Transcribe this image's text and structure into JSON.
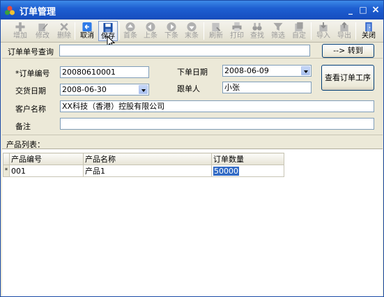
{
  "window": {
    "title": "订单管理"
  },
  "toolbar": {
    "buttons": [
      {
        "label": "增加",
        "icon": "plus-icon",
        "enabled": false
      },
      {
        "label": "修改",
        "icon": "edit-icon",
        "enabled": false
      },
      {
        "label": "删除",
        "icon": "delete-icon",
        "enabled": false
      },
      {
        "label": "取消",
        "icon": "undo-icon",
        "enabled": true
      },
      {
        "label": "保存",
        "icon": "save-icon",
        "enabled": true
      },
      {
        "label": "首条",
        "icon": "first-record-icon",
        "enabled": false
      },
      {
        "label": "上条",
        "icon": "previous-record-icon",
        "enabled": false
      },
      {
        "label": "下条",
        "icon": "next-record-icon",
        "enabled": false
      },
      {
        "label": "末条",
        "icon": "last-record-icon",
        "enabled": false
      },
      {
        "label": "刷新",
        "icon": "refresh-icon",
        "enabled": false
      },
      {
        "label": "打印",
        "icon": "print-icon",
        "enabled": false
      },
      {
        "label": "查找",
        "icon": "binoculars-icon",
        "enabled": false
      },
      {
        "label": "筛选",
        "icon": "filter-icon",
        "enabled": false
      },
      {
        "label": "自定",
        "icon": "customize-icon",
        "enabled": false
      },
      {
        "label": "导入",
        "icon": "import-icon",
        "enabled": false
      },
      {
        "label": "导出",
        "icon": "export-icon",
        "enabled": false
      },
      {
        "label": "关闭",
        "icon": "exit-door-icon",
        "enabled": true
      }
    ]
  },
  "search": {
    "label": "订单单号查询",
    "value": "",
    "goto_label": "--> 转到"
  },
  "form": {
    "order_no_label": "*订单编号",
    "order_no_value": "20080610001",
    "order_date_label": "下单日期",
    "order_date_value": "2008-06-09",
    "delivery_date_label": "交货日期",
    "delivery_date_value": "2008-06-30",
    "follower_label": "跟单人",
    "follower_value": "小张",
    "customer_label": "客户名称",
    "customer_value": "XX科技（香港）控股有限公司",
    "remark_label": "备注",
    "remark_value": "",
    "process_button_label": "查看订单工序"
  },
  "products": {
    "section_label": "产品列表：",
    "columns": [
      "产品编号",
      "产品名称",
      "订单数量"
    ],
    "rows": [
      {
        "code": "001",
        "name": "产品1",
        "qty": "50000"
      }
    ],
    "new_row_marker": "*"
  },
  "colors": {
    "titlebar": "#1e5fd1",
    "window_bg": "#ece9d8",
    "selection": "#316ac5"
  }
}
